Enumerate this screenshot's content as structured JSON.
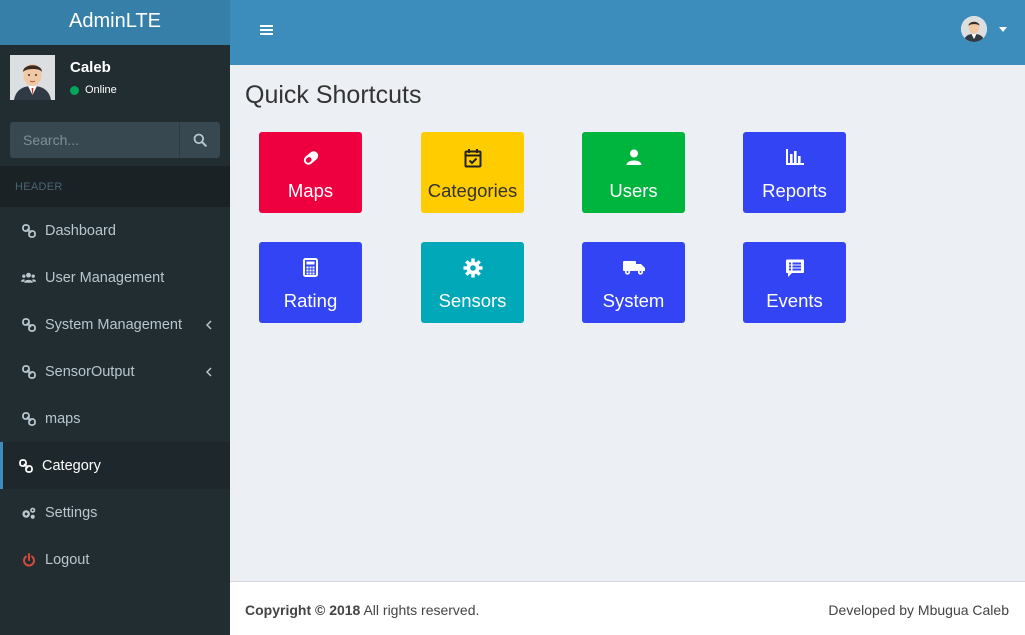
{
  "app": {
    "logo_text": "AdminLTE"
  },
  "user": {
    "name": "Caleb",
    "status": "Online"
  },
  "search": {
    "placeholder": "Search..."
  },
  "sidebar": {
    "header": "HEADER",
    "items": [
      {
        "label": "Dashboard",
        "icon": "link-icon"
      },
      {
        "label": "User Management",
        "icon": "users-icon"
      },
      {
        "label": "System Management",
        "icon": "link-icon",
        "has_submenu": true
      },
      {
        "label": "SensorOutput",
        "icon": "link-icon",
        "has_submenu": true
      },
      {
        "label": "maps",
        "icon": "link-icon"
      },
      {
        "label": "Category",
        "icon": "link-icon",
        "active": true
      },
      {
        "label": "Settings",
        "icon": "cogs-icon"
      },
      {
        "label": "Logout",
        "icon": "power-icon"
      }
    ]
  },
  "main": {
    "title": "Quick Shortcuts",
    "shortcuts": [
      {
        "label": "Maps",
        "icon": "eraser-icon",
        "color": "#ee0040"
      },
      {
        "label": "Categories",
        "icon": "calendar-check-icon",
        "color": "#ffcc00"
      },
      {
        "label": "Users",
        "icon": "user-icon",
        "color": "#00b53d"
      },
      {
        "label": "Reports",
        "icon": "bar-chart-icon",
        "color": "#3344f5"
      },
      {
        "label": "Rating",
        "icon": "calculator-icon",
        "color": "#3344f5"
      },
      {
        "label": "Sensors",
        "icon": "gear-icon",
        "color": "#00a8b8"
      },
      {
        "label": "System",
        "icon": "truck-icon",
        "color": "#3344f5"
      },
      {
        "label": "Events",
        "icon": "comment-list-icon",
        "color": "#3344f5"
      }
    ]
  },
  "footer": {
    "copyright_bold": "Copyright © 2018",
    "copyright_rest": " All rights reserved.",
    "credit": "Developed by Mbugua Caleb"
  },
  "colors": {
    "sidebar_bg": "#222d32",
    "logo_bg": "#367fa9",
    "header_bg": "#3c8dbc",
    "content_bg": "#ecf0f5",
    "online": "#00a65a",
    "logout": "#dd4b39"
  }
}
